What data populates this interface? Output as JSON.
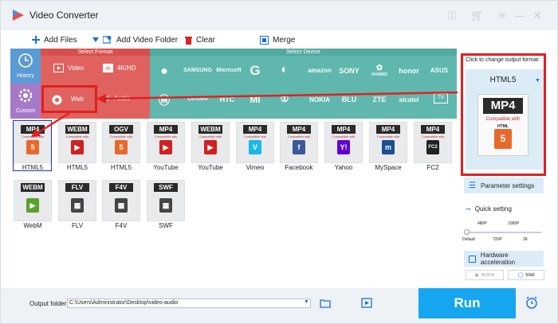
{
  "window": {
    "title": "Video Converter",
    "icons": [
      "key-icon",
      "cart-icon",
      "menu-icon",
      "minimize-icon",
      "close-icon"
    ]
  },
  "toolbar": {
    "add_files": "Add Files",
    "add_video_folder": "Add Video Folder",
    "clear": "Clear",
    "merge": "Merge"
  },
  "sidebar": {
    "history": "History",
    "custom": "Custom"
  },
  "format_panel": {
    "select_format": "Select Format",
    "select_device": "Select Device",
    "categories": [
      "Video",
      "4K/HD",
      "Web",
      "Audio"
    ],
    "devices_row1": [
      "Apple",
      "SAMSUNG",
      "Microsoft",
      "Google",
      "LG",
      "amazon",
      "SONY",
      "HUAWEI",
      "honor",
      "ASUS"
    ],
    "devices_row2": [
      "Motorola",
      "Lenovo",
      "HTC",
      "MI",
      "OnePlus",
      "NOKIA",
      "BLU",
      "ZTE",
      "alcatel",
      "TV"
    ]
  },
  "tiles": [
    {
      "tag": "MP4",
      "sub": "Compatible with",
      "emblem": "5",
      "emblem_color": "#e86a2b",
      "caption": "HTML5",
      "selected": true
    },
    {
      "tag": "WEBM",
      "sub": "Compatible with",
      "emblem": "▶",
      "emblem_color": "#d02020",
      "caption": "HTML5"
    },
    {
      "tag": "OGV",
      "sub": "Compatible with",
      "emblem": "5",
      "emblem_color": "#e86a2b",
      "caption": "HTML5"
    },
    {
      "tag": "MP4",
      "sub": "Compatible with",
      "emblem": "▶",
      "emblem_color": "#d02020",
      "caption": "YouTube"
    },
    {
      "tag": "WEBM",
      "sub": "Compatible with",
      "emblem": "▶",
      "emblem_color": "#d02020",
      "caption": "YouTube"
    },
    {
      "tag": "MP4",
      "sub": "Compatible with",
      "emblem": "V",
      "emblem_color": "#1ab7ea",
      "caption": "Vimeo"
    },
    {
      "tag": "MP4",
      "sub": "Compatible with",
      "emblem": "f",
      "emblem_color": "#3b5998",
      "caption": "Facebook"
    },
    {
      "tag": "MP4",
      "sub": "Compatible with",
      "emblem": "Y!",
      "emblem_color": "#6001d2",
      "caption": "Yahoo"
    },
    {
      "tag": "MP4",
      "sub": "Compatible with",
      "emblem": "m",
      "emblem_color": "#1d4f91",
      "caption": "MySpace"
    },
    {
      "tag": "MP4",
      "sub": "Compatible with",
      "emblem": "FC2",
      "emblem_color": "#222222",
      "caption": "FC2"
    },
    {
      "tag": "WEBM",
      "sub": "",
      "emblem": "▶",
      "emblem_color": "#5aa02c",
      "caption": "WebM"
    },
    {
      "tag": "FLV",
      "sub": "",
      "emblem": "▦",
      "emblem_color": "#444444",
      "caption": "FLV"
    },
    {
      "tag": "F4V",
      "sub": "",
      "emblem": "▦",
      "emblem_color": "#444444",
      "caption": "F4V"
    },
    {
      "tag": "SWF",
      "sub": "",
      "emblem": "▦",
      "emblem_color": "#444444",
      "caption": "SWF"
    }
  ],
  "output_panel": {
    "hint": "Click to change output format:",
    "selected_format": "HTML5",
    "card_tag": "MP4",
    "card_sub": "Compatible with",
    "card_sub2": "HTML",
    "card_emblem": "5",
    "parameter_settings": "Parameter settings",
    "quick_setting": "Quick setting",
    "quality_top": [
      "480P",
      "1080P"
    ],
    "quality_bottom": [
      "Default",
      "720P",
      "2K"
    ],
    "hardware_acceleration": "Hardware acceleration",
    "nvidia": "NVIDIA",
    "intel": "Intel"
  },
  "bottom": {
    "output_folder_label": "Output folder:",
    "output_folder_value": "C:\\Users\\Administrator\\Desktop\\video-audio",
    "run": "Run"
  },
  "colors": {
    "format_red": "#e0625f",
    "device_teal": "#5fb7ad",
    "side_blue": "#5b9bd5",
    "side_purple": "#a77ac9",
    "annotation_red": "#e02020",
    "run_blue": "#16a6f0",
    "select_blue": "#2233aa"
  }
}
